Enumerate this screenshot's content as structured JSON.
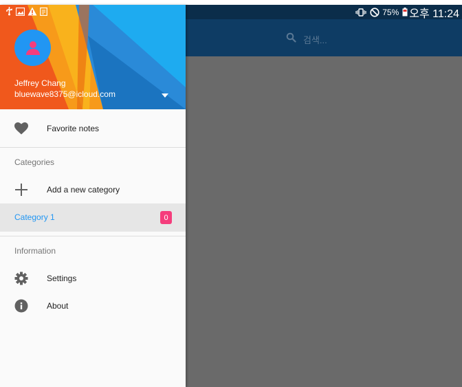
{
  "status_bar": {
    "battery_text": "75%",
    "time": "오후 11:24",
    "left_icons": [
      "usb-icon",
      "image-icon",
      "warning-icon",
      "clipboard-icon"
    ],
    "right_icons": [
      "vibrate-icon",
      "do-not-disturb-icon",
      "battery-icon"
    ]
  },
  "app_bar": {
    "search_placeholder": "검색..."
  },
  "drawer": {
    "user": {
      "name": "Jeffrey Chang",
      "email": "bluewave8375@icloud.com"
    },
    "favorite_label": "Favorite notes",
    "categories_title": "Categories",
    "add_category_label": "Add a new category",
    "categories": [
      {
        "label": "Category 1",
        "count": "0",
        "selected": true
      }
    ],
    "information_title": "Information",
    "settings_label": "Settings",
    "about_label": "About"
  },
  "colors": {
    "accent": "#2196f3",
    "badge": "#f53d7c",
    "appbar": "#0e3c64",
    "statusbar": "#0b2d4a",
    "overlay": "#6a6a6a"
  }
}
